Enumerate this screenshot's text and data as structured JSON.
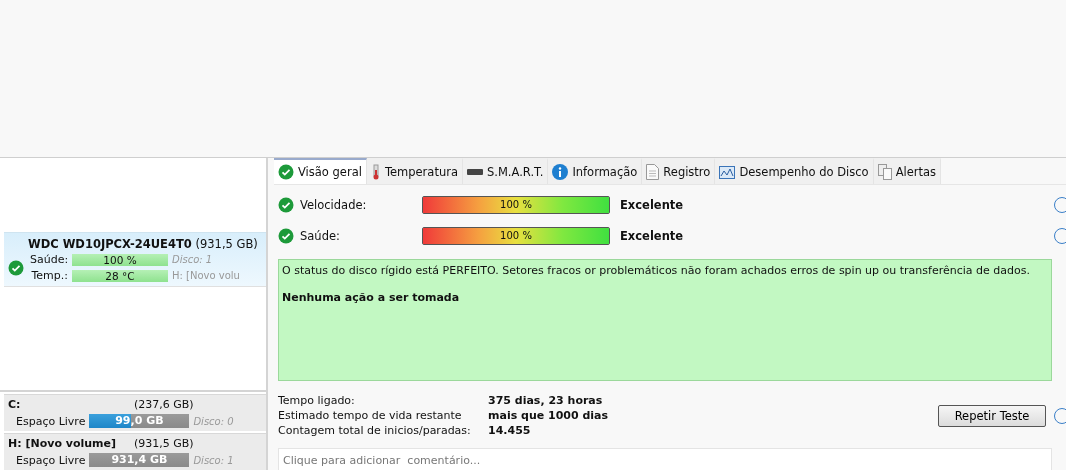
{
  "disk": {
    "name": "WDC WD10JPCX-24UE4T0",
    "size": "(931,5 GB)",
    "ok": true,
    "selected": true,
    "metrics": [
      {
        "label": "Saúde:",
        "reading": "100 %",
        "level": 1,
        "side": "Disco: 1",
        "italic": true
      },
      {
        "label": "Temp.:",
        "reading": "28 °C",
        "level": 1,
        "side": "H: [Novo volu",
        "italic": false
      }
    ]
  },
  "volumes": [
    {
      "name": "C:",
      "size": "(237,6 GB)",
      "free_label": "Espaço Livre",
      "free": "99,0 GB",
      "level": 0.42,
      "disk": "Disco: 0"
    },
    {
      "name": "H: [Novo volume]",
      "size": "(931,5 GB)",
      "free_label": "Espaço Livre",
      "free": "931,4 GB",
      "level": 0,
      "disk": "Disco: 1"
    }
  ],
  "tabs": [
    {
      "label": "Visão geral",
      "kind": "check",
      "selected": true
    },
    {
      "label": "Temperatura",
      "kind": "thermometer",
      "selected": false
    },
    {
      "label": "S.M.A.R.T.",
      "kind": "drive",
      "selected": false
    },
    {
      "label": "Informação",
      "kind": "info",
      "selected": false
    },
    {
      "label": "Registro",
      "kind": "document",
      "selected": false
    },
    {
      "label": "Desempenho do Disco",
      "kind": "chart",
      "selected": false
    },
    {
      "label": "Alertas",
      "kind": "pages",
      "selected": false
    }
  ],
  "ratings": [
    {
      "label": "Velocidade:",
      "ok": true,
      "reading": "100 %",
      "level": 1,
      "verdict": "Excelente"
    },
    {
      "label": "Saúde:",
      "ok": true,
      "reading": "100 %",
      "level": 1,
      "verdict": "Excelente"
    }
  ],
  "status": {
    "text": "O status do disco rígido está PERFEITO. Setores fracos or problemáticos não foram achados erros de spin up ou transferência de dados.",
    "action": "Nenhuma ação a ser tomada"
  },
  "info": [
    {
      "label": "Tempo ligado:",
      "value": "375 dias, 23 horas"
    },
    {
      "label": "Estimado tempo de vida restante",
      "value": "mais que 1000 dias"
    },
    {
      "label": "Contagem total de inicios/paradas:",
      "value": "14.455"
    }
  ],
  "button": "Repetir Teste",
  "comment": {
    "placeholder": "Clique para adicionar  comentário..."
  }
}
